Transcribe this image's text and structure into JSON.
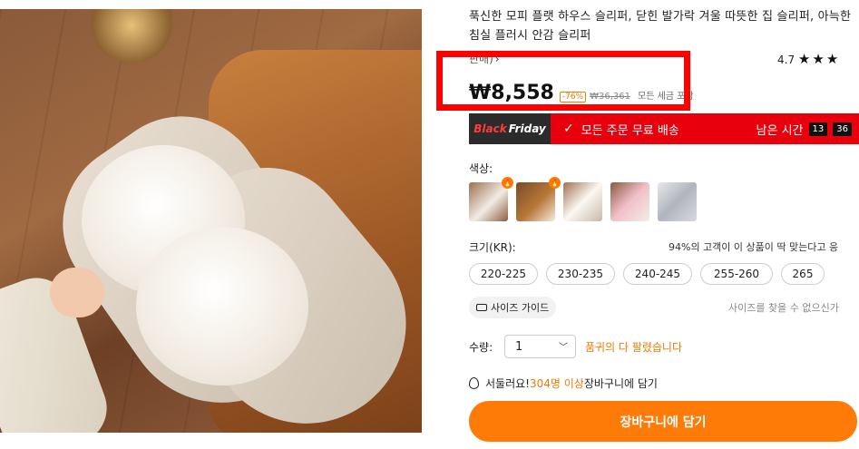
{
  "product": {
    "title": "푹신한 모피 플랫 하우스 슬리퍼, 닫힌 발가락 겨울 따뜻한 집 슬리퍼, 아늑한 침실 플러시 안감 슬리퍼",
    "sold_text": "판매)",
    "rating": "4.7",
    "stars": "★★★"
  },
  "price": {
    "current": "₩8,558",
    "discount": "-76%",
    "original": "₩36,361",
    "tax_note": "모든 세금 포함"
  },
  "promo": {
    "tag_black": "Black",
    "tag_friday": "Friday",
    "free_shipping": "모든 주문 무료 배송",
    "time_left_label": "남은 시간",
    "hours": "13",
    "minutes": "36"
  },
  "color": {
    "label": "색상:",
    "swatches": [
      "sw1",
      "sw2",
      "sw3",
      "sw4",
      "sw5"
    ],
    "hot_badge": "🔥"
  },
  "size": {
    "label": "크기(KR):",
    "fit_text": "94%의 고객이 이 상품이 딱 맞는다고 응",
    "options": [
      "220-225",
      "230-235",
      "240-245",
      "255-260",
      "265"
    ],
    "guide_label": "사이즈 가이드",
    "help_text": "사이즈를 찾을 수 없으신가"
  },
  "quantity": {
    "label": "수량:",
    "value": "1",
    "warning": "품귀의 다 팔렸습니다"
  },
  "cart_note": {
    "prefix": "서둘러요!",
    "count": "304명 이상",
    "suffix": " 장바구니에 담기"
  },
  "add_to_cart": "장바구니에 담기",
  "colors": {
    "accent": "#ff7b08",
    "promo_red": "#e8000c",
    "highlight": "#ff0000"
  }
}
